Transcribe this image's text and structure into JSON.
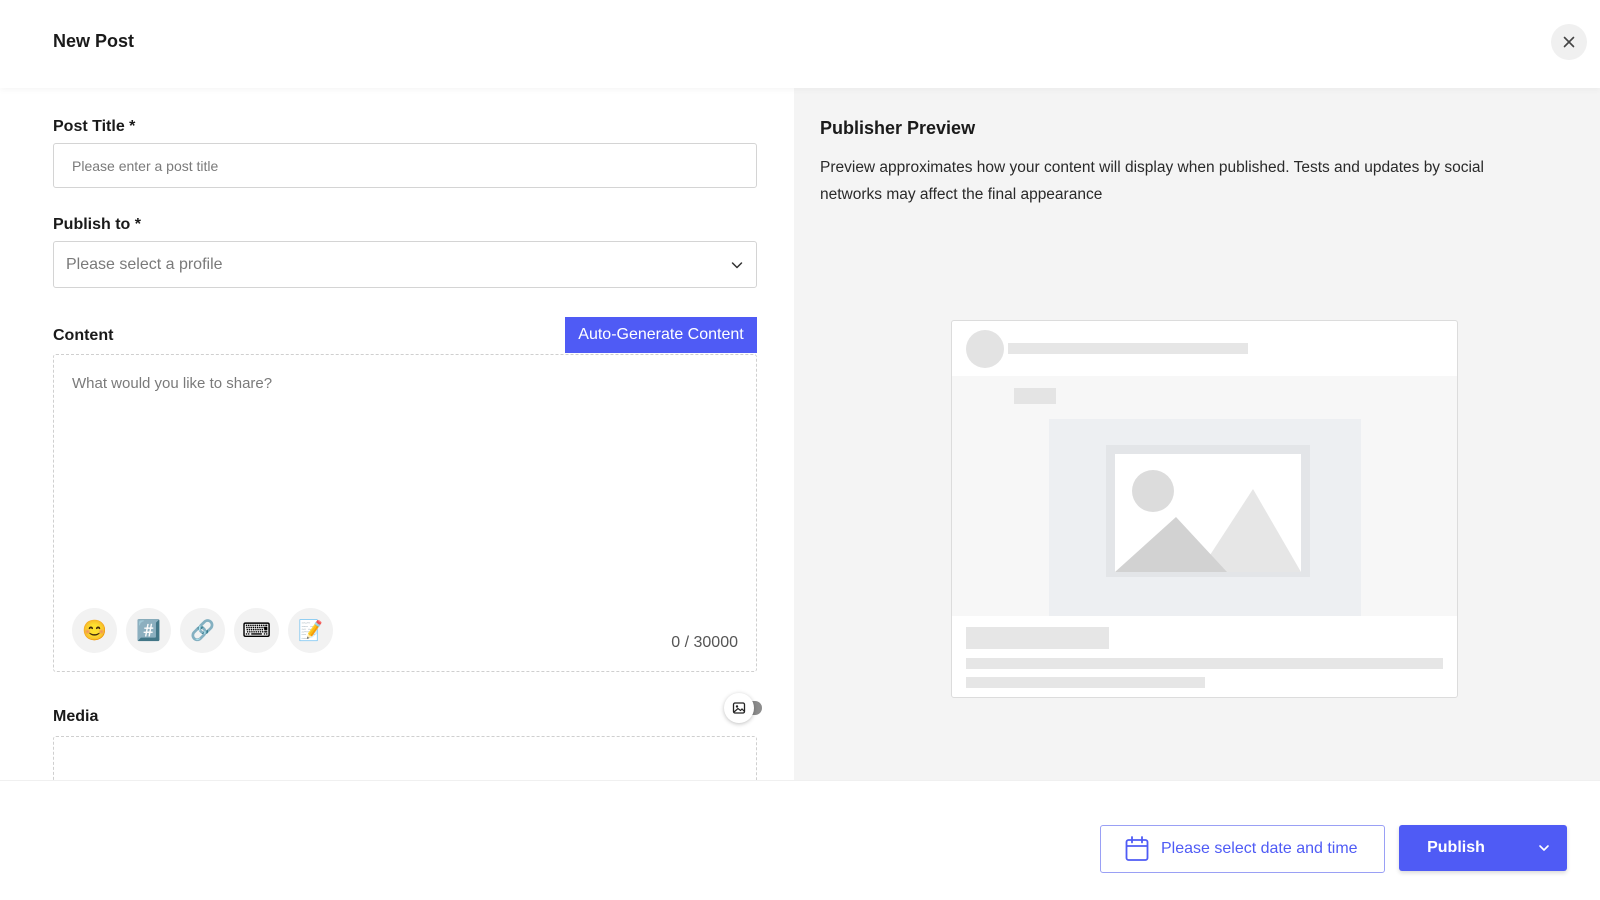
{
  "header": {
    "title": "New Post"
  },
  "form": {
    "post_title_label": "Post Title *",
    "post_title_placeholder": "Please enter a post title",
    "publish_to_label": "Publish to *",
    "publish_to_placeholder": "Please select a profile",
    "content_label": "Content",
    "auto_generate_label": "Auto-Generate Content",
    "content_placeholder": "What would you like to share?",
    "char_counter": "0 / 30000",
    "media_label": "Media",
    "tools": [
      {
        "name": "emoji-icon",
        "glyph": "😊"
      },
      {
        "name": "hashtag-icon",
        "glyph": "#️⃣"
      },
      {
        "name": "link-icon",
        "glyph": "🔗"
      },
      {
        "name": "typewriter-icon",
        "glyph": "⌨"
      },
      {
        "name": "memo-icon",
        "glyph": "📝"
      }
    ]
  },
  "preview": {
    "title": "Publisher Preview",
    "description": "Preview approximates how your content will display when published. Tests and updates by social networks may affect the final appearance"
  },
  "footer": {
    "date_placeholder": "Please select date and time",
    "publish_label": "Publish"
  },
  "colors": {
    "accent": "#4f5bf5",
    "panel_bg": "#f4f4f4"
  }
}
